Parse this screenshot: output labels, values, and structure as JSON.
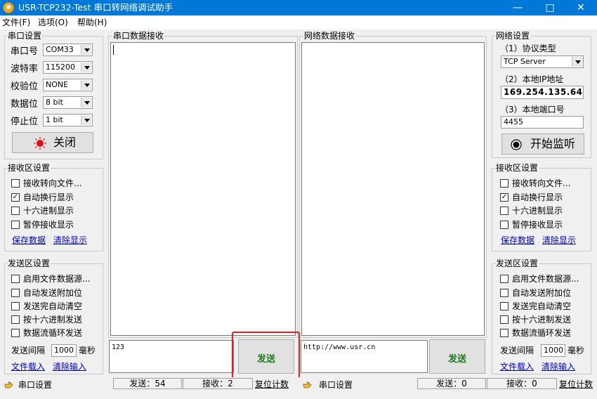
{
  "window": {
    "title": "USR-TCP232-Test 串口转网络调试助手"
  },
  "menu": [
    "文件(F)",
    "选项(O)",
    "帮助(H)"
  ],
  "serial_settings": {
    "title": "串口设置",
    "port_label": "串口号",
    "port_value": "COM33",
    "baud_label": "波特率",
    "baud_value": "115200",
    "parity_label": "校验位",
    "parity_value": "NONE",
    "databits_label": "数据位",
    "databits_value": "8 bit",
    "stopbits_label": "停止位",
    "stopbits_value": "1 bit",
    "close_button": "关闭"
  },
  "serial_receive": {
    "title": "串口数据接收"
  },
  "network_receive": {
    "title": "网络数据接收"
  },
  "left_recv": {
    "title": "接收区设置",
    "options": [
      {
        "label": "接收转向文件...",
        "checked": false
      },
      {
        "label": "自动换行显示",
        "checked": true
      },
      {
        "label": "十六进制显示",
        "checked": false
      },
      {
        "label": "暂停接收显示",
        "checked": false
      }
    ],
    "save_link": "保存数据",
    "clear_link": "清除显示"
  },
  "left_send": {
    "title": "发送区设置",
    "options": [
      {
        "label": "启用文件数据源...",
        "checked": false
      },
      {
        "label": "自动发送附加位",
        "checked": false
      },
      {
        "label": "发送完自动清空",
        "checked": false
      },
      {
        "label": "按十六进制发送",
        "checked": false
      },
      {
        "label": "数据流循环发送",
        "checked": false
      }
    ],
    "interval_label": "发送间隔",
    "interval_value": "1000",
    "interval_unit": "毫秒",
    "load_link": "文件载入",
    "clear_link": "清除输入"
  },
  "network_settings": {
    "title": "网络设置",
    "protocol_label": "（1）协议类型",
    "protocol_value": "TCP Server",
    "ip_label": "（2）本地IP地址",
    "ip_value": "169.254.135.64",
    "port_label": "（3）本地端口号",
    "port_value": "4455",
    "listen_button": "开始监听"
  },
  "right_recv": {
    "title": "接收区设置",
    "options": [
      {
        "label": "接收转向文件...",
        "checked": false
      },
      {
        "label": "自动换行显示",
        "checked": true
      },
      {
        "label": "十六进制显示",
        "checked": false
      },
      {
        "label": "暂停接收显示",
        "checked": false
      }
    ],
    "save_link": "保存数据",
    "clear_link": "清除显示"
  },
  "right_send": {
    "title": "发送区设置",
    "options": [
      {
        "label": "启用文件数据源...",
        "checked": false
      },
      {
        "label": "自动发送附加位",
        "checked": false
      },
      {
        "label": "发送完自动清空",
        "checked": false
      },
      {
        "label": "按十六进制发送",
        "checked": false
      },
      {
        "label": "数据流循环发送",
        "checked": false
      }
    ],
    "interval_label": "发送间隔",
    "interval_value": "1000",
    "interval_unit": "毫秒",
    "load_link": "文件载入",
    "clear_link": "清除输入"
  },
  "serial_send": {
    "input_value": "123",
    "send_button": "发送"
  },
  "network_send": {
    "input_value": "http://www.usr.cn",
    "send_button": "发送"
  },
  "status_left": {
    "label": "串口设置",
    "sent": "发送：54",
    "received": "接收：2",
    "reset": "复位计数"
  },
  "status_right": {
    "label": "串口设置",
    "sent": "发送：0",
    "received": "接收：0",
    "reset": "复位计数"
  },
  "colors": {
    "titlebar": "#0078d7",
    "send_button_text": "#1f7a1f",
    "highlight_border": "#e02020",
    "link": "#0000cc"
  }
}
